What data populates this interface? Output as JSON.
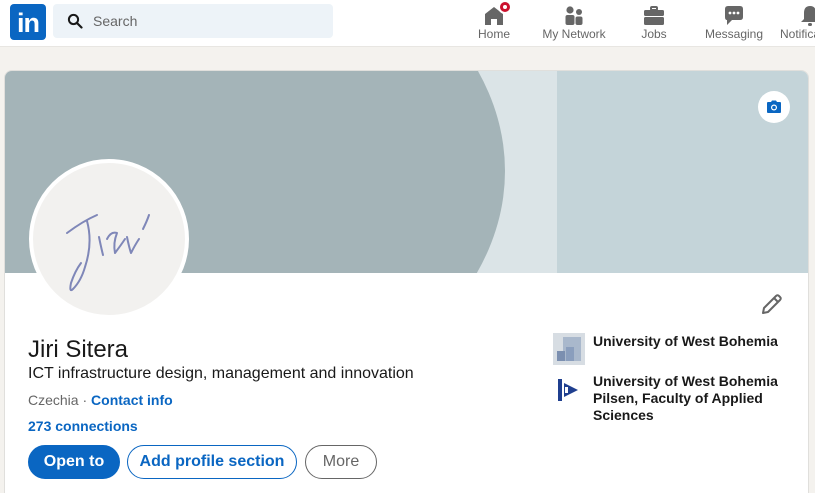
{
  "nav": {
    "logo_text": "in",
    "search_placeholder": "Search",
    "items": [
      {
        "label": "Home",
        "icon": "home-icon"
      },
      {
        "label": "My Network",
        "icon": "network-icon"
      },
      {
        "label": "Jobs",
        "icon": "briefcase-icon"
      },
      {
        "label": "Messaging",
        "icon": "messaging-icon"
      },
      {
        "label": "Notifications",
        "icon": "bell-icon"
      }
    ]
  },
  "profile": {
    "signature_text": "Jiri",
    "name": "Jiri Sitera",
    "headline": "ICT infrastructure design, management and innovation",
    "location": "Czechia",
    "separator": " · ",
    "contact_info": "Contact info",
    "connections": "273 connections",
    "buttons": {
      "open_to": "Open to",
      "add_section": "Add profile section",
      "more": "More"
    },
    "organizations": [
      {
        "label": "University of West Bohemia"
      },
      {
        "label": "University of West Bohemia Pilsen, Faculty of Applied Sciences"
      }
    ]
  },
  "colors": {
    "brand": "#0a66c2",
    "notification_badge": "#cb112d",
    "banner_main": "#a4b4b8",
    "banner_light": "#c4d4d9"
  }
}
